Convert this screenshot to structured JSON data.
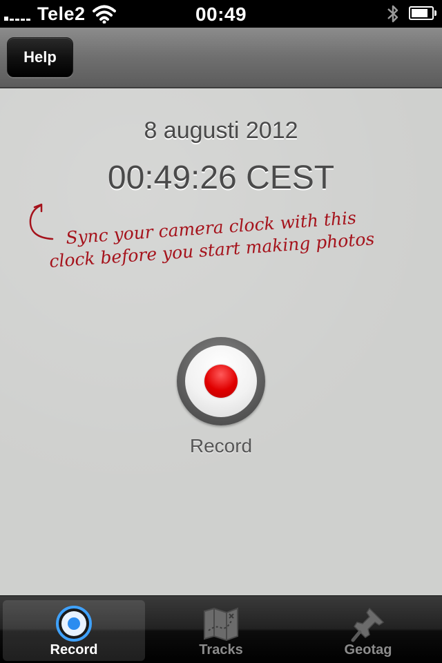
{
  "status_bar": {
    "carrier": "Tele2",
    "time": "00:49",
    "battery_level": 0.85,
    "icons": [
      "signal-icon",
      "wifi-icon",
      "bluetooth-icon",
      "battery-icon"
    ]
  },
  "nav_bar": {
    "help_label": "Help"
  },
  "main": {
    "date": "8 augusti 2012",
    "time": "00:49:26 CEST",
    "hint_line1": "Sync your camera clock with this",
    "hint_line2": "clock before you start making photos",
    "record_label": "Record"
  },
  "tab_bar": {
    "tabs": [
      {
        "label": "Record",
        "icon": "record-icon",
        "active": true
      },
      {
        "label": "Tracks",
        "icon": "map-icon",
        "active": false
      },
      {
        "label": "Geotag",
        "icon": "pushpin-icon",
        "active": false
      }
    ]
  },
  "colors": {
    "record_red": "#e00000",
    "hint_red": "#a5121b",
    "active_tab_blue": "#2b8cf0"
  }
}
